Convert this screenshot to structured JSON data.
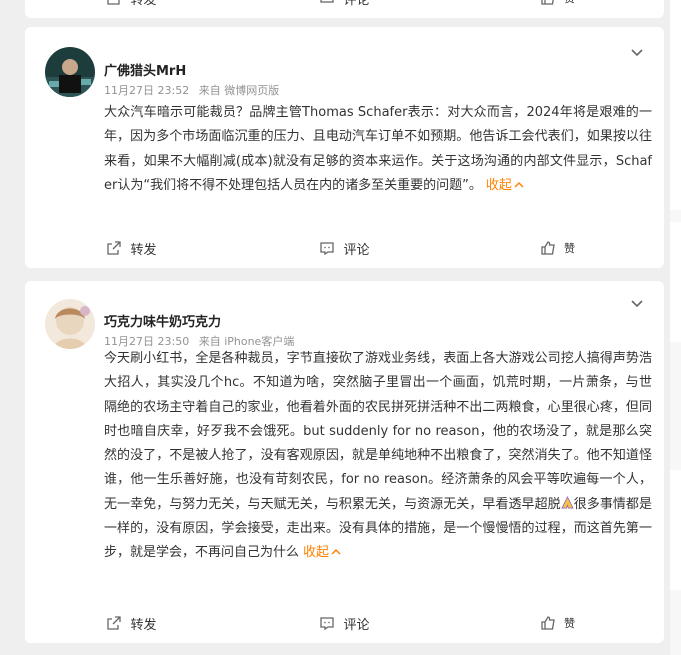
{
  "prev_card": {
    "actions": {
      "repost": "转发",
      "comment": "评论",
      "like": "赞"
    }
  },
  "post1": {
    "author": "广佛猎头MrH",
    "date": "11月27日 23:52",
    "source": "来自 微博网页版",
    "text": "大众汽车暗示可能裁员？品牌主管Thomas Schafer表示：对大众而言，2024年将是艰难的一年，因为多个市场面临沉重的压力、且电动汽车订单不如预期。他告诉工会代表们，如果按以往来看，如果不大幅削减(成本)就没有足够的资本来运作。关于这场沟通的内部文件显示，Schafer认为“我们将不得不处理包括人员在内的诸多至关重要的问题”。",
    "collapse": "收起",
    "actions": {
      "repost": "转发",
      "comment": "评论",
      "like": "赞"
    }
  },
  "post2": {
    "author": "巧克力味牛奶巧克力",
    "date": "11月27日 23:50",
    "source": "来自 iPhone客户端",
    "text_a": "今天刷小红书，全是各种裁员，字节直接砍了游戏业务线，表面上各大游戏公司挖人搞得声势浩大招人，其实没几个hc。不知道为啥，突然脑子里冒出一个画面，饥荒时期，一片萧条，与世隔绝的农场主守着自己的家业，他看着外面的农民拼死拼活种不出二两粮食，心里很心疼，但同时也暗自庆幸，好歹我不会饿死。but suddenly for no reason，他的农场没了，就是那么突然的没了，不是被人抢了，没有客观原因，就是单纯地种不出粮食了，突然消失了。他不知道怪谁，他一生乐善好施，也没有苛刻农民，for no reason。经济萧条的风会平等吹遍每一个人，无一幸免，与努力无关，与天赋无关，与积累无关，与资源无关，早看透早超脱",
    "text_b": "很多事情都是一样的，没有原因，学会接受，走出来。没有具体的措施，是一个慢慢悟的过程，而这首先第一步，就是学会，不再问自己为什么",
    "collapse": "收起",
    "actions": {
      "repost": "转发",
      "comment": "评论",
      "like": "赞"
    }
  },
  "colors": {
    "accent": "#ff8200",
    "meta": "#939393",
    "bg": "#efefef"
  }
}
